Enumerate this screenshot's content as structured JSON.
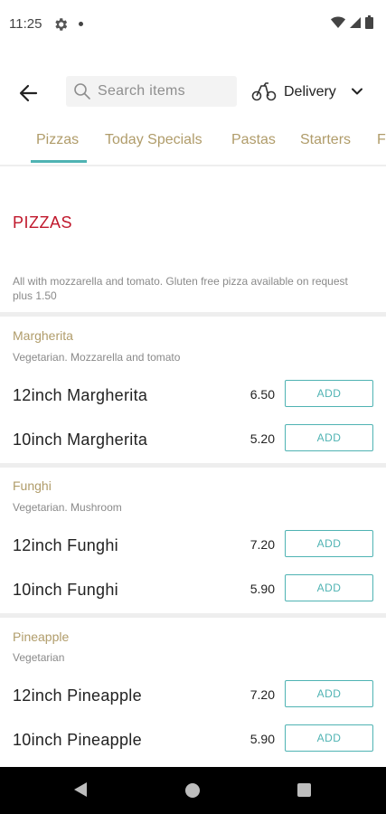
{
  "status": {
    "time": "11:25"
  },
  "topbar": {
    "search_placeholder": "Search items",
    "delivery_label": "Delivery"
  },
  "tabs": [
    {
      "label": "Pizzas",
      "active": true
    },
    {
      "label": "Today Specials"
    },
    {
      "label": "Pastas"
    },
    {
      "label": "Starters"
    },
    {
      "label": "F"
    }
  ],
  "section": {
    "title": "PIZZAS",
    "description": "All with mozzarella and tomato. Gluten free pizza available on request plus 1.50"
  },
  "groups": [
    {
      "name": "Margherita",
      "description": "Vegetarian. Mozzarella and tomato",
      "items": [
        {
          "name": "12inch Margherita",
          "price": "6.50",
          "button": "ADD"
        },
        {
          "name": "10inch Margherita",
          "price": "5.20",
          "button": "ADD"
        }
      ]
    },
    {
      "name": "Funghi",
      "description": "Vegetarian. Mushroom",
      "items": [
        {
          "name": "12inch Funghi",
          "price": "7.20",
          "button": "ADD"
        },
        {
          "name": "10inch Funghi",
          "price": "5.90",
          "button": "ADD"
        }
      ]
    },
    {
      "name": "Pineapple",
      "description": "Vegetarian",
      "items": [
        {
          "name": "12inch Pineapple",
          "price": "7.20",
          "button": "ADD"
        },
        {
          "name": "10inch Pineapple",
          "price": "5.90",
          "button": "ADD"
        }
      ]
    }
  ],
  "colors": {
    "accent": "#4fb3b3",
    "gold": "#b09c6a",
    "section_title": "#c0182c"
  },
  "icons": {
    "back": "arrow-left-icon",
    "search": "search-icon",
    "delivery": "scooter-icon",
    "dropdown": "chevron-down-icon"
  }
}
